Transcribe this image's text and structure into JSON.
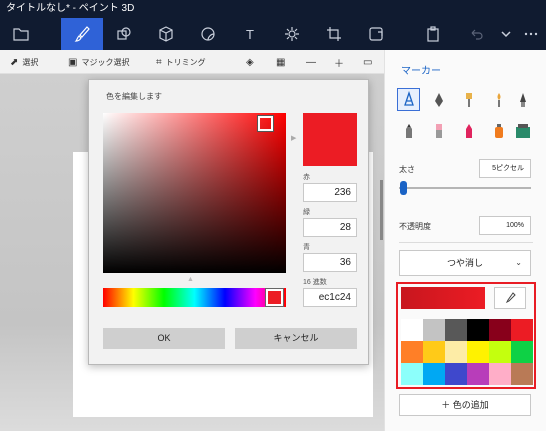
{
  "window": {
    "title": "タイトルなし* - ペイント 3D"
  },
  "toolbar": {
    "items": [
      {
        "name": "menu-folder-icon"
      },
      {
        "name": "brushes-icon",
        "active": true
      },
      {
        "name": "2d-shapes-icon"
      },
      {
        "name": "3d-shapes-icon"
      },
      {
        "name": "stickers-icon"
      },
      {
        "name": "text-icon",
        "glyph": "T"
      },
      {
        "name": "effects-icon"
      },
      {
        "name": "canvas-icon"
      },
      {
        "name": "remix3d-icon"
      },
      {
        "name": "paste-icon"
      },
      {
        "name": "undo-icon"
      },
      {
        "name": "more-icon"
      }
    ]
  },
  "subbar": {
    "select_label": "選択",
    "magic_select_label": "マジック選択",
    "crop_label": "トリミング"
  },
  "dialog": {
    "title": "色を編集します",
    "red_label": "赤",
    "red_value": "236",
    "green_label": "緑",
    "green_value": "28",
    "blue_label": "青",
    "blue_value": "36",
    "hex_label": "16 進数",
    "hex_value": "ec1c24",
    "ok_label": "OK",
    "cancel_label": "キャンセル"
  },
  "panel": {
    "title": "マーカー",
    "thickness_label": "太さ",
    "thickness_value": "5ピクセル",
    "opacity_label": "不透明度",
    "opacity_value": "100%",
    "opacity_level": 1.0,
    "thickness_level": 0.05,
    "finish_label": "つや消し",
    "add_color_label": "色の追加",
    "current_color": "#ec1c24"
  },
  "tools": [
    {
      "name": "marker-tool-icon",
      "active": true
    },
    {
      "name": "calligraphy-pen-tool-icon"
    },
    {
      "name": "oil-brush-tool-icon"
    },
    {
      "name": "watercolor-tool-icon"
    },
    {
      "name": "pixel-pen-tool-icon"
    },
    {
      "name": "pencil-tool-icon"
    },
    {
      "name": "eraser-tool-icon"
    },
    {
      "name": "crayon-tool-icon"
    },
    {
      "name": "spray-can-tool-icon"
    },
    {
      "name": "fill-tool-icon"
    }
  ],
  "palette": [
    "#ffffff",
    "#c3c3c3",
    "#585858",
    "#000000",
    "#88001b",
    "#ec1c24",
    "#ff7f27",
    "#ffca18",
    "#fdeca6",
    "#fff200",
    "#c4ff0e",
    "#0ed145",
    "#8cfffb",
    "#00a8f3",
    "#3f48cc",
    "#b83dba",
    "#ffaec8",
    "#b97a56"
  ]
}
